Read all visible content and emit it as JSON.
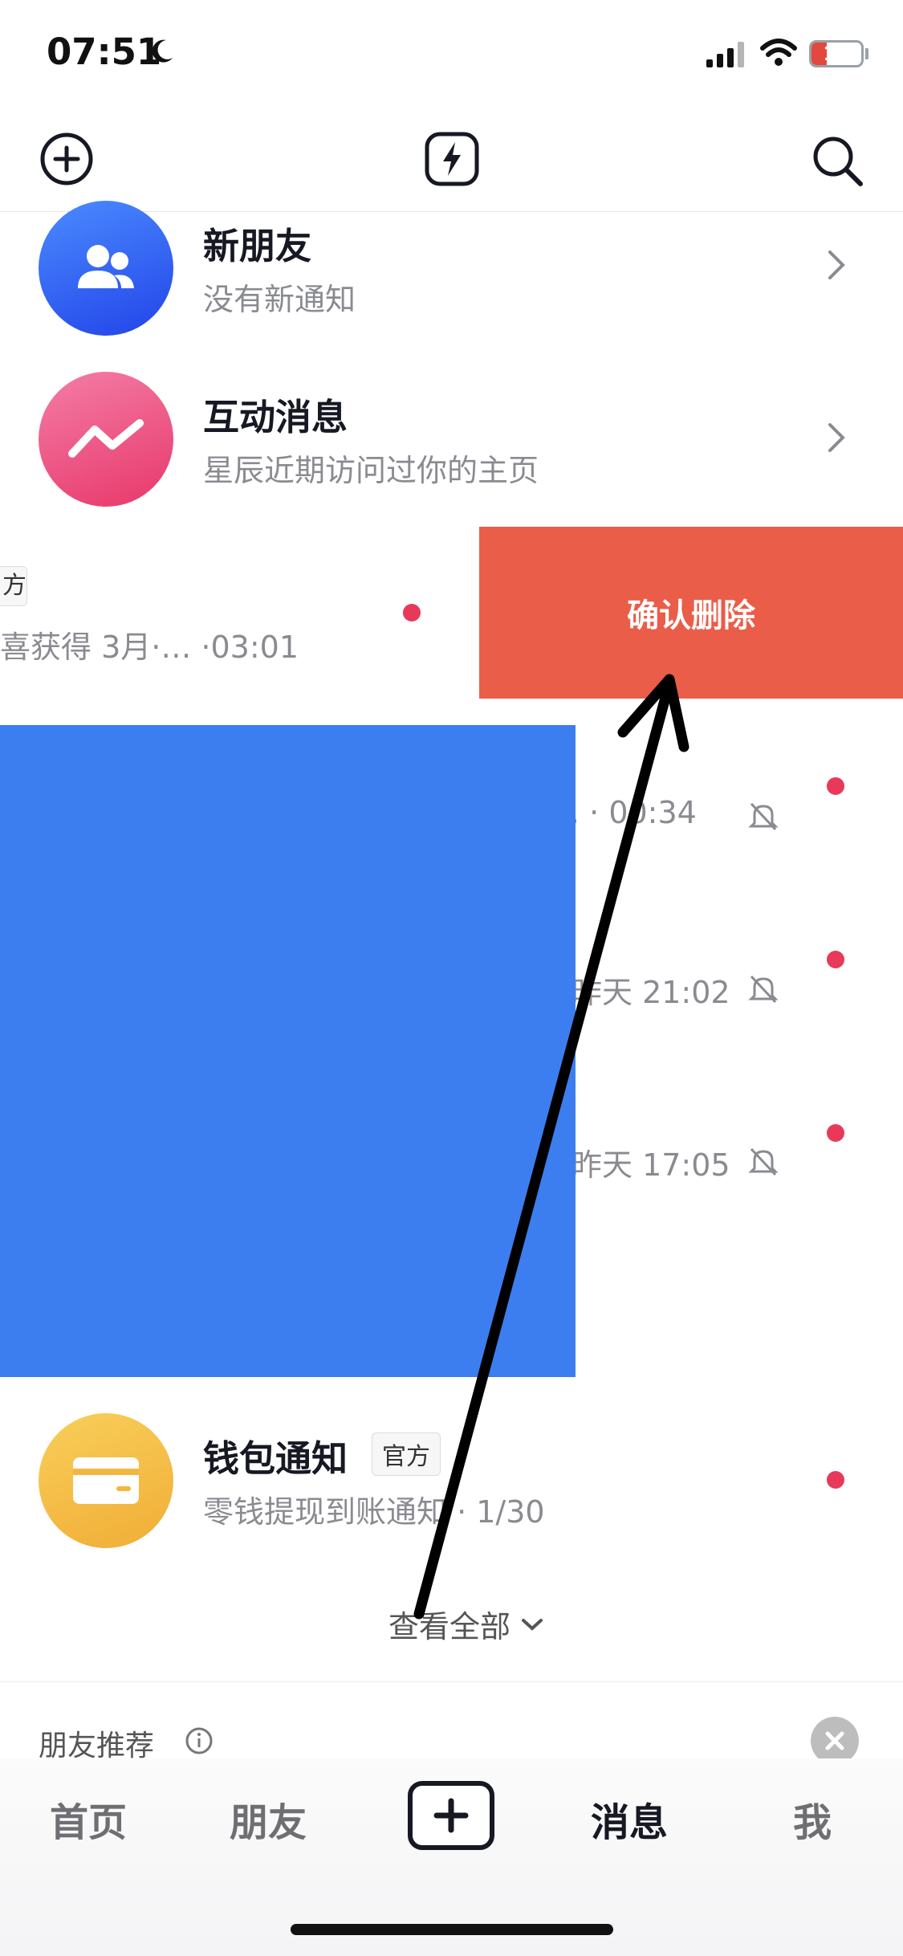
{
  "status_bar": {
    "time": "07:51",
    "battery": "17"
  },
  "rows": {
    "new_friends": {
      "title": "新朋友",
      "subtitle": "没有新通知"
    },
    "interactions": {
      "title": "互动消息",
      "subtitle": "星辰近期访问过你的主页"
    },
    "swiped_row": {
      "tag": "方",
      "subtitle": "喜获得  3月·…  ·03:01"
    },
    "muted_row_1": {
      "time": ".  · 00:34"
    },
    "muted_row_2": {
      "time": "昨天 21:02"
    },
    "muted_row_3": {
      "time": "昨天 17:05"
    },
    "wallet": {
      "title": "钱包通知",
      "badge": "官方",
      "subtitle": "零钱提现到账通知 · 1/30"
    }
  },
  "delete_button": "确认删除",
  "view_all": "查看全部",
  "recommend": {
    "title": "朋友推荐"
  },
  "tabbar": {
    "home": "首页",
    "friends": "朋友",
    "messages": "消息",
    "me": "我"
  },
  "colors": {
    "delete": "#ea5d49",
    "unread_dot": "#e8395a",
    "redaction": "#3c7ef0"
  }
}
